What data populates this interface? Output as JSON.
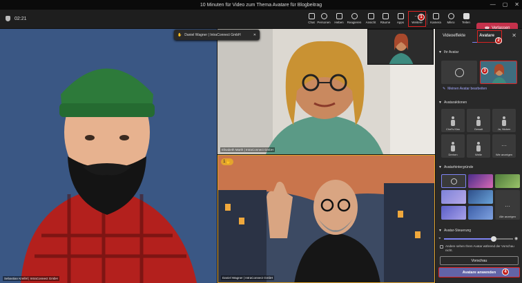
{
  "window": {
    "title": "10 Minuten für Video zum Thema Avatare für Blogbeitrag",
    "controls": [
      "—",
      "▢",
      "✕"
    ]
  },
  "toolbar": {
    "timer": "02:21",
    "buttons": [
      {
        "label": "Chat",
        "icon": "chat-icon"
      },
      {
        "label": "Personen",
        "icon": "people-icon"
      },
      {
        "label": "Heben",
        "icon": "raise-hand-icon"
      },
      {
        "label": "Reagieren",
        "icon": "react-icon"
      },
      {
        "label": "Ansicht",
        "icon": "view-icon"
      },
      {
        "label": "Räume",
        "icon": "rooms-icon"
      },
      {
        "label": "Apps",
        "icon": "apps-icon"
      },
      {
        "label": "Weitere",
        "icon": "more-icon"
      },
      {
        "label": "Kamera",
        "icon": "camera-icon"
      },
      {
        "label": "Mikro",
        "icon": "mic-icon"
      },
      {
        "label": "Teilen",
        "icon": "share-icon"
      }
    ],
    "leave_label": "Verlassen",
    "more_glyph": "···"
  },
  "markers": {
    "m1": "1",
    "m2": "2",
    "m3": "3",
    "m4": "4"
  },
  "stage": {
    "toast": "Daniel Wagner | IntraConnect GmbH",
    "toast_close": "✕",
    "participants": [
      {
        "name": "Sebastian Kreifel | IntraConnect GmbH"
      },
      {
        "name": "Elisabeth Marth | IntraConnect GmbH"
      },
      {
        "name": "Daniel Wagner | IntraConnect GmbH"
      }
    ],
    "hand_count": "1"
  },
  "panel": {
    "tabs": [
      "Videoeffekte",
      "Avatare"
    ],
    "close": "✕",
    "sec_avatar": "Ihr Avatar",
    "edit_link": "Meinen Avatar bearbeiten",
    "sec_actions": "Avataraktionen",
    "actions": [
      "Chef's Kiss",
      "Gewalt",
      "Ja, Nicken",
      "Drehen",
      "Welle",
      "Wie anzeigen"
    ],
    "sec_backgrounds": "Avatarhintergründe",
    "show_all": "Alle anzeigen",
    "sec_control": "Avatar-Steuerung",
    "checkbox_text": "Andere sehen Ihren Avatar während der Vorschau nicht.",
    "preview_btn": "Vorschau",
    "apply_btn": "Avatare anwenden"
  }
}
